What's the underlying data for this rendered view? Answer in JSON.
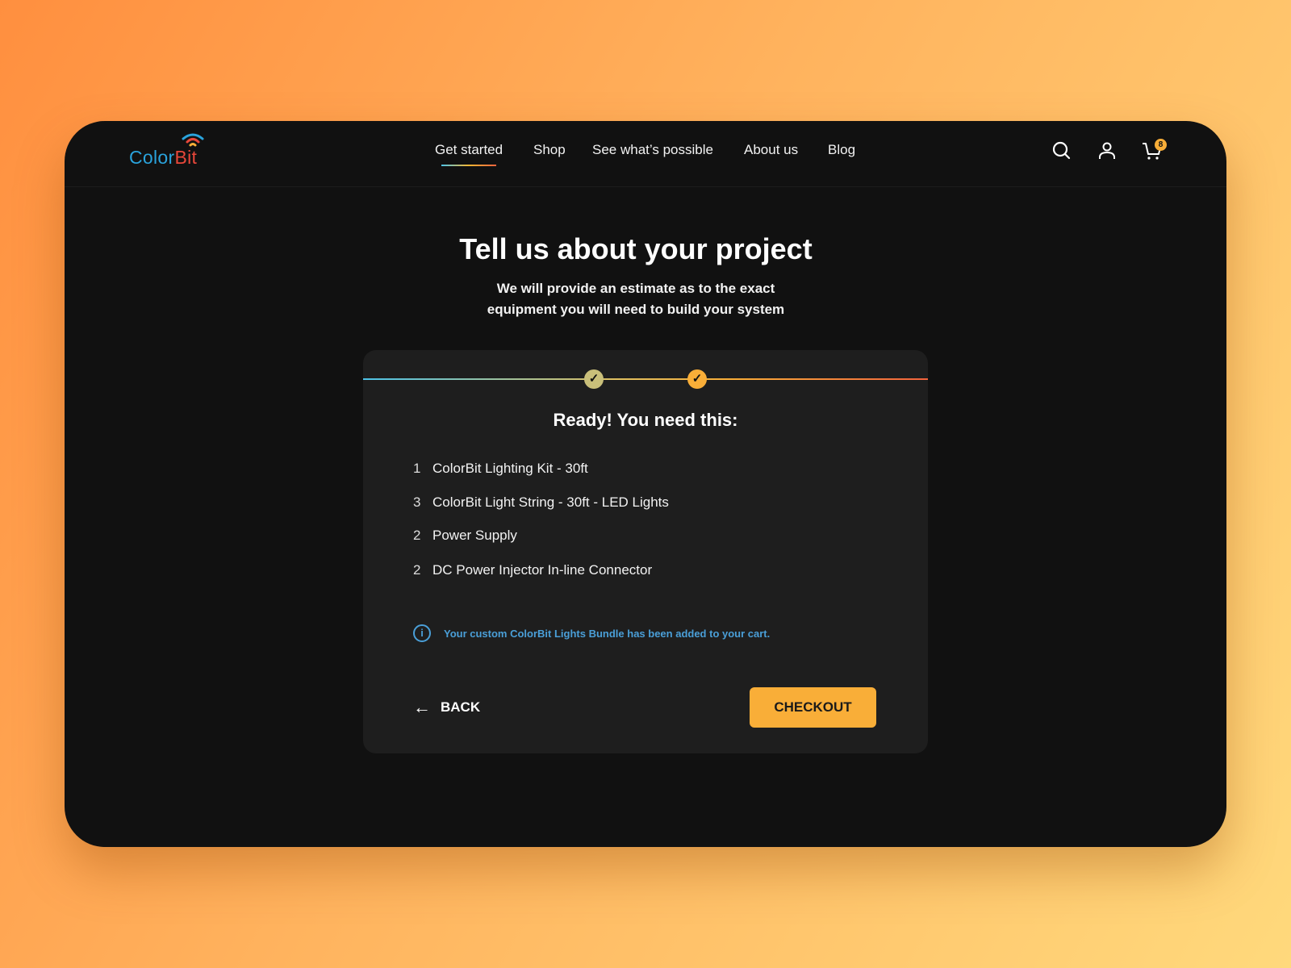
{
  "brand": {
    "logo_part1": "Color",
    "logo_part2": "Bit"
  },
  "nav": [
    {
      "label": "Get started",
      "active": true
    },
    {
      "label": "Shop"
    },
    {
      "label": "See what’s possible"
    },
    {
      "label": "About us"
    },
    {
      "label": "Blog"
    }
  ],
  "cart": {
    "count": "8"
  },
  "page": {
    "title": "Tell us about your project",
    "subtitle_line1": "We will provide an estimate as to the exact",
    "subtitle_line2": "equipment you will need to build your system"
  },
  "card": {
    "steps": [
      {
        "icon": "✓",
        "done": true
      },
      {
        "icon": "✓",
        "done": true
      }
    ],
    "heading": "Ready! You need this:",
    "items": [
      {
        "qty": "1",
        "name": "ColorBit Lighting Kit - 30ft"
      },
      {
        "qty": "3",
        "name": "ColorBit Light String - 30ft - LED Lights"
      },
      {
        "qty": "2",
        "name": "Power Supply"
      },
      {
        "qty": "2",
        "name": "DC Power Injector In-line Connector"
      }
    ],
    "info": "Your custom ColorBit Lights Bundle has been added to your cart.",
    "back_label": "BACK",
    "checkout_label": "CHECKOUT"
  },
  "colors": {
    "accent": "#f9ae38",
    "info": "#4a9fd8",
    "brand_blue": "#2aa3dc",
    "brand_red": "#e8473a"
  }
}
